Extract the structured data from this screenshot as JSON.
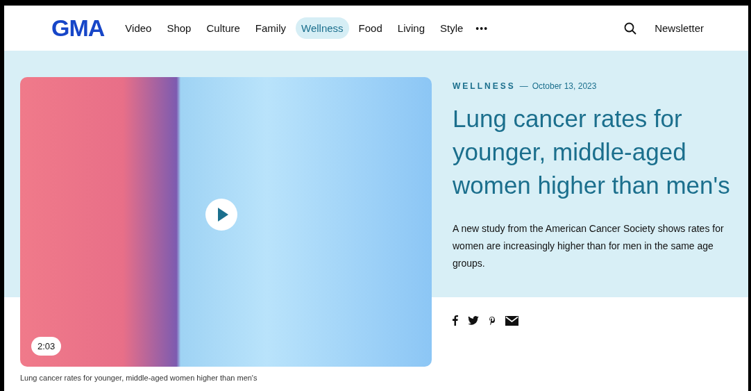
{
  "header": {
    "logo": "GMA",
    "nav": [
      {
        "label": "Video",
        "selected": false
      },
      {
        "label": "Shop",
        "selected": false
      },
      {
        "label": "Culture",
        "selected": false
      },
      {
        "label": "Family",
        "selected": false
      },
      {
        "label": "Wellness",
        "selected": true
      },
      {
        "label": "Food",
        "selected": false
      },
      {
        "label": "Living",
        "selected": false
      },
      {
        "label": "Style",
        "selected": false
      }
    ],
    "more": "•••",
    "newsletter": "Newsletter"
  },
  "video": {
    "duration": "2:03",
    "caption": "Lung cancer rates for younger, middle-aged women higher than men's"
  },
  "article": {
    "category": "WELLNESS",
    "separator": "—",
    "date": "October 13, 2023",
    "headline": "Lung cancer rates for younger, middle-aged women higher than men's",
    "summary": "A new study from the American Cancer Society shows rates for women are increasingly higher than for men in the same age groups."
  }
}
